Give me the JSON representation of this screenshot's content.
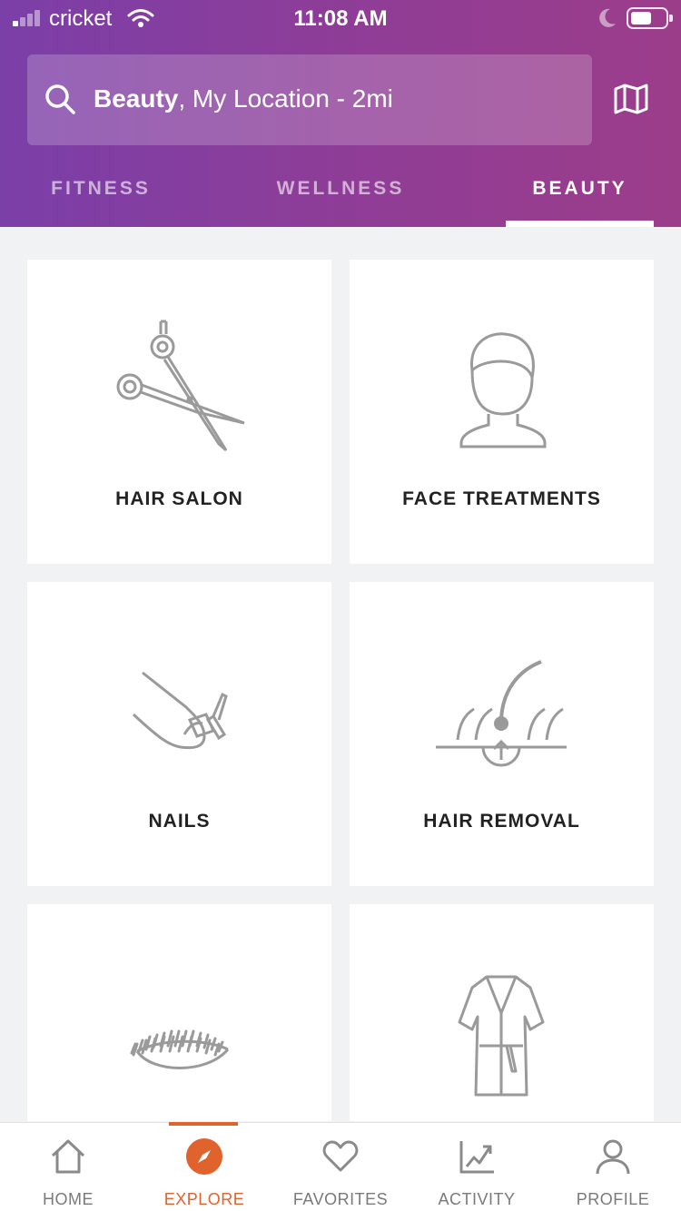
{
  "status_bar": {
    "carrier": "cricket",
    "time": "11:08 AM",
    "battery_level": 0.6
  },
  "search": {
    "category": "Beauty",
    "location": ", My Location - 2mi"
  },
  "tabs": [
    {
      "label": "FITNESS",
      "active": false
    },
    {
      "label": "WELLNESS",
      "active": false
    },
    {
      "label": "BEAUTY",
      "active": true
    }
  ],
  "categories": [
    {
      "label": "HAIR SALON",
      "icon": "scissors-icon"
    },
    {
      "label": "FACE TREATMENTS",
      "icon": "face-towel-icon"
    },
    {
      "label": "NAILS",
      "icon": "nail-polish-icon"
    },
    {
      "label": "HAIR REMOVAL",
      "icon": "hair-follicle-icon"
    },
    {
      "label": "",
      "icon": "eyelash-icon"
    },
    {
      "label": "",
      "icon": "robe-icon"
    }
  ],
  "bottom_nav": [
    {
      "label": "HOME",
      "icon": "home-icon",
      "active": false
    },
    {
      "label": "EXPLORE",
      "icon": "compass-icon",
      "active": true
    },
    {
      "label": "FAVORITES",
      "icon": "heart-icon",
      "active": false
    },
    {
      "label": "ACTIVITY",
      "icon": "chart-icon",
      "active": false
    },
    {
      "label": "PROFILE",
      "icon": "user-icon",
      "active": false
    }
  ],
  "colors": {
    "header_gradient_start": "#7b3fa8",
    "header_gradient_end": "#9c3d8a",
    "accent": "#e0622d",
    "icon_gray": "#999999"
  }
}
